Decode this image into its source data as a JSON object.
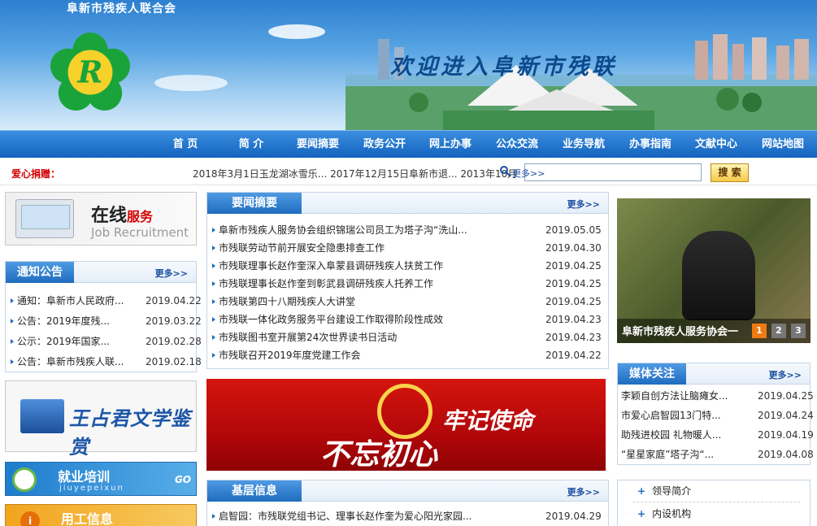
{
  "header": {
    "org_name": "阜新市残疾人联合会",
    "welcome": "欢迎进入阜新市残联",
    "logo_letter": "R"
  },
  "nav": [
    "首 页",
    "简 介",
    "要闻摘要",
    "政务公开",
    "网上办事",
    "公众交流",
    "业务导航",
    "办事指南",
    "文献中心",
    "网站地图"
  ],
  "donate": {
    "label": "爱心捐赠：",
    "marquee": "2018年3月1日玉龙湖冰雪乐...  2017年12月15日阜新市退...  2013年10月一",
    "search_more": "更多>>",
    "search_placeholder": "",
    "search_button": "搜 索"
  },
  "online_service": {
    "t1_main": "在线",
    "t1_accent": "服务",
    "t2": "Job Recruitment"
  },
  "notice": {
    "title": "通知公告",
    "more": "更多>>",
    "items": [
      {
        "text": "通知：阜新市人民政府...",
        "date": "2019.04.22"
      },
      {
        "text": "公告：2019年度残...",
        "date": "2019.03.22"
      },
      {
        "text": "公示：2019年国家...",
        "date": "2019.02.28"
      },
      {
        "text": "公告：阜新市残疾人联...",
        "date": "2019.02.18"
      }
    ]
  },
  "literature_banner": "王占君文学鉴赏",
  "job_training": {
    "title": "就业培训",
    "pinyin": "jiuyepeixun",
    "go": "GO"
  },
  "work_info": {
    "title": "用工信息",
    "icon": "i"
  },
  "news": {
    "title": "要闻摘要",
    "more": "更多>>",
    "items": [
      {
        "text": "阜新市残疾人服务协会组织锦瑞公司员工为塔子沟“洗山...",
        "date": "2019.05.05"
      },
      {
        "text": "市残联劳动节前开展安全隐患排查工作",
        "date": "2019.04.30"
      },
      {
        "text": "市残联理事长赵作奎深入阜蒙县调研残疾人扶贫工作",
        "date": "2019.04.25"
      },
      {
        "text": "市残联理事长赵作奎到彰武县调研残疾人托养工作",
        "date": "2019.04.25"
      },
      {
        "text": "市残联第四十八期残疾人大讲堂",
        "date": "2019.04.25"
      },
      {
        "text": "市残联一体化政务服务平台建设工作取得阶段性成效",
        "date": "2019.04.23"
      },
      {
        "text": "市残联图书室开展第24次世界读书日活动",
        "date": "2019.04.23"
      },
      {
        "text": "市残联召开2019年度党建工作会",
        "date": "2019.04.22"
      }
    ]
  },
  "party_banner": {
    "line1": "牢记使命",
    "line2": "不忘初心"
  },
  "grassroots": {
    "title": "基层信息",
    "more": "更多>>",
    "items": [
      {
        "text": "启智园：市残联党组书记、理事长赵作奎为爱心阳光家园...",
        "date": "2019.04.29"
      }
    ]
  },
  "slideshow": {
    "caption": "阜新市残疾人服务协会一",
    "pages": [
      "1",
      "2",
      "3"
    ],
    "active": 0
  },
  "media": {
    "title": "媒体关注",
    "more": "更多>>",
    "items": [
      {
        "text": "李颖自创方法让脑瘫女...",
        "date": "2019.04.25"
      },
      {
        "text": "市爱心启智园13门特...",
        "date": "2019.04.24"
      },
      {
        "text": "助残进校园 礼物暖人...",
        "date": "2019.04.19"
      },
      {
        "text": "“星星家庭”塔子沟“...",
        "date": "2019.04.08"
      }
    ]
  },
  "quick_links": [
    "领导简介",
    "内设机构"
  ],
  "colors": {
    "brand_blue": "#1f6cbf",
    "donate_red": "#d40000",
    "party_red": "#c40c0a"
  }
}
